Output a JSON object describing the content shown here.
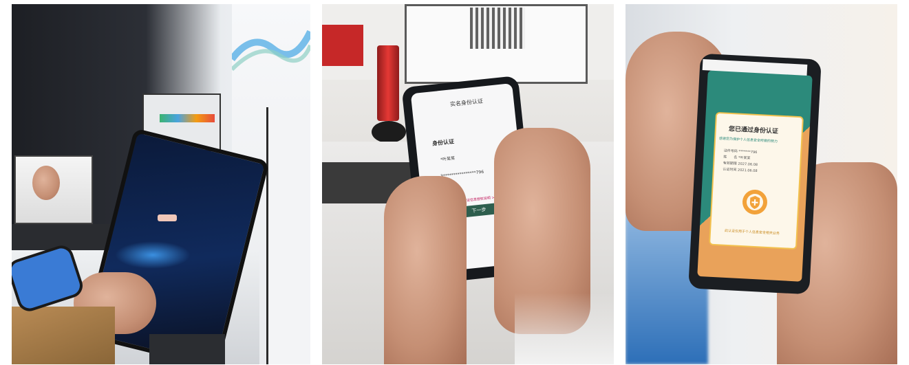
{
  "photos": [
    {
      "id": "tablet-kiosk"
    },
    {
      "id": "phone-form"
    },
    {
      "id": "phone-success"
    }
  ],
  "form_screen": {
    "header": "实名身份认证",
    "section": "身份认证",
    "name": "*叶某某",
    "id_number": "3****************796",
    "link": "查看网上居民身份证信息授权说明 >",
    "button": "下一步"
  },
  "success_screen": {
    "title": "您已通过身份认证",
    "subtitle": "感谢您为保护个人信息安全所做的努力",
    "rows": [
      {
        "label": "证件号码",
        "value": "*******796"
      },
      {
        "label": "姓　　名",
        "value": "*叶某某"
      },
      {
        "label": "有效期限",
        "value": "2027.06.08"
      },
      {
        "label": "认证时间",
        "value": "2021.06.08"
      }
    ],
    "footer": "此认证仅用于个人信息安全相关业务"
  },
  "colors": {
    "primary": "#2e5e4e",
    "accent": "#f2a23a",
    "teal": "#2c8a7b",
    "pink": "#c2185b"
  }
}
